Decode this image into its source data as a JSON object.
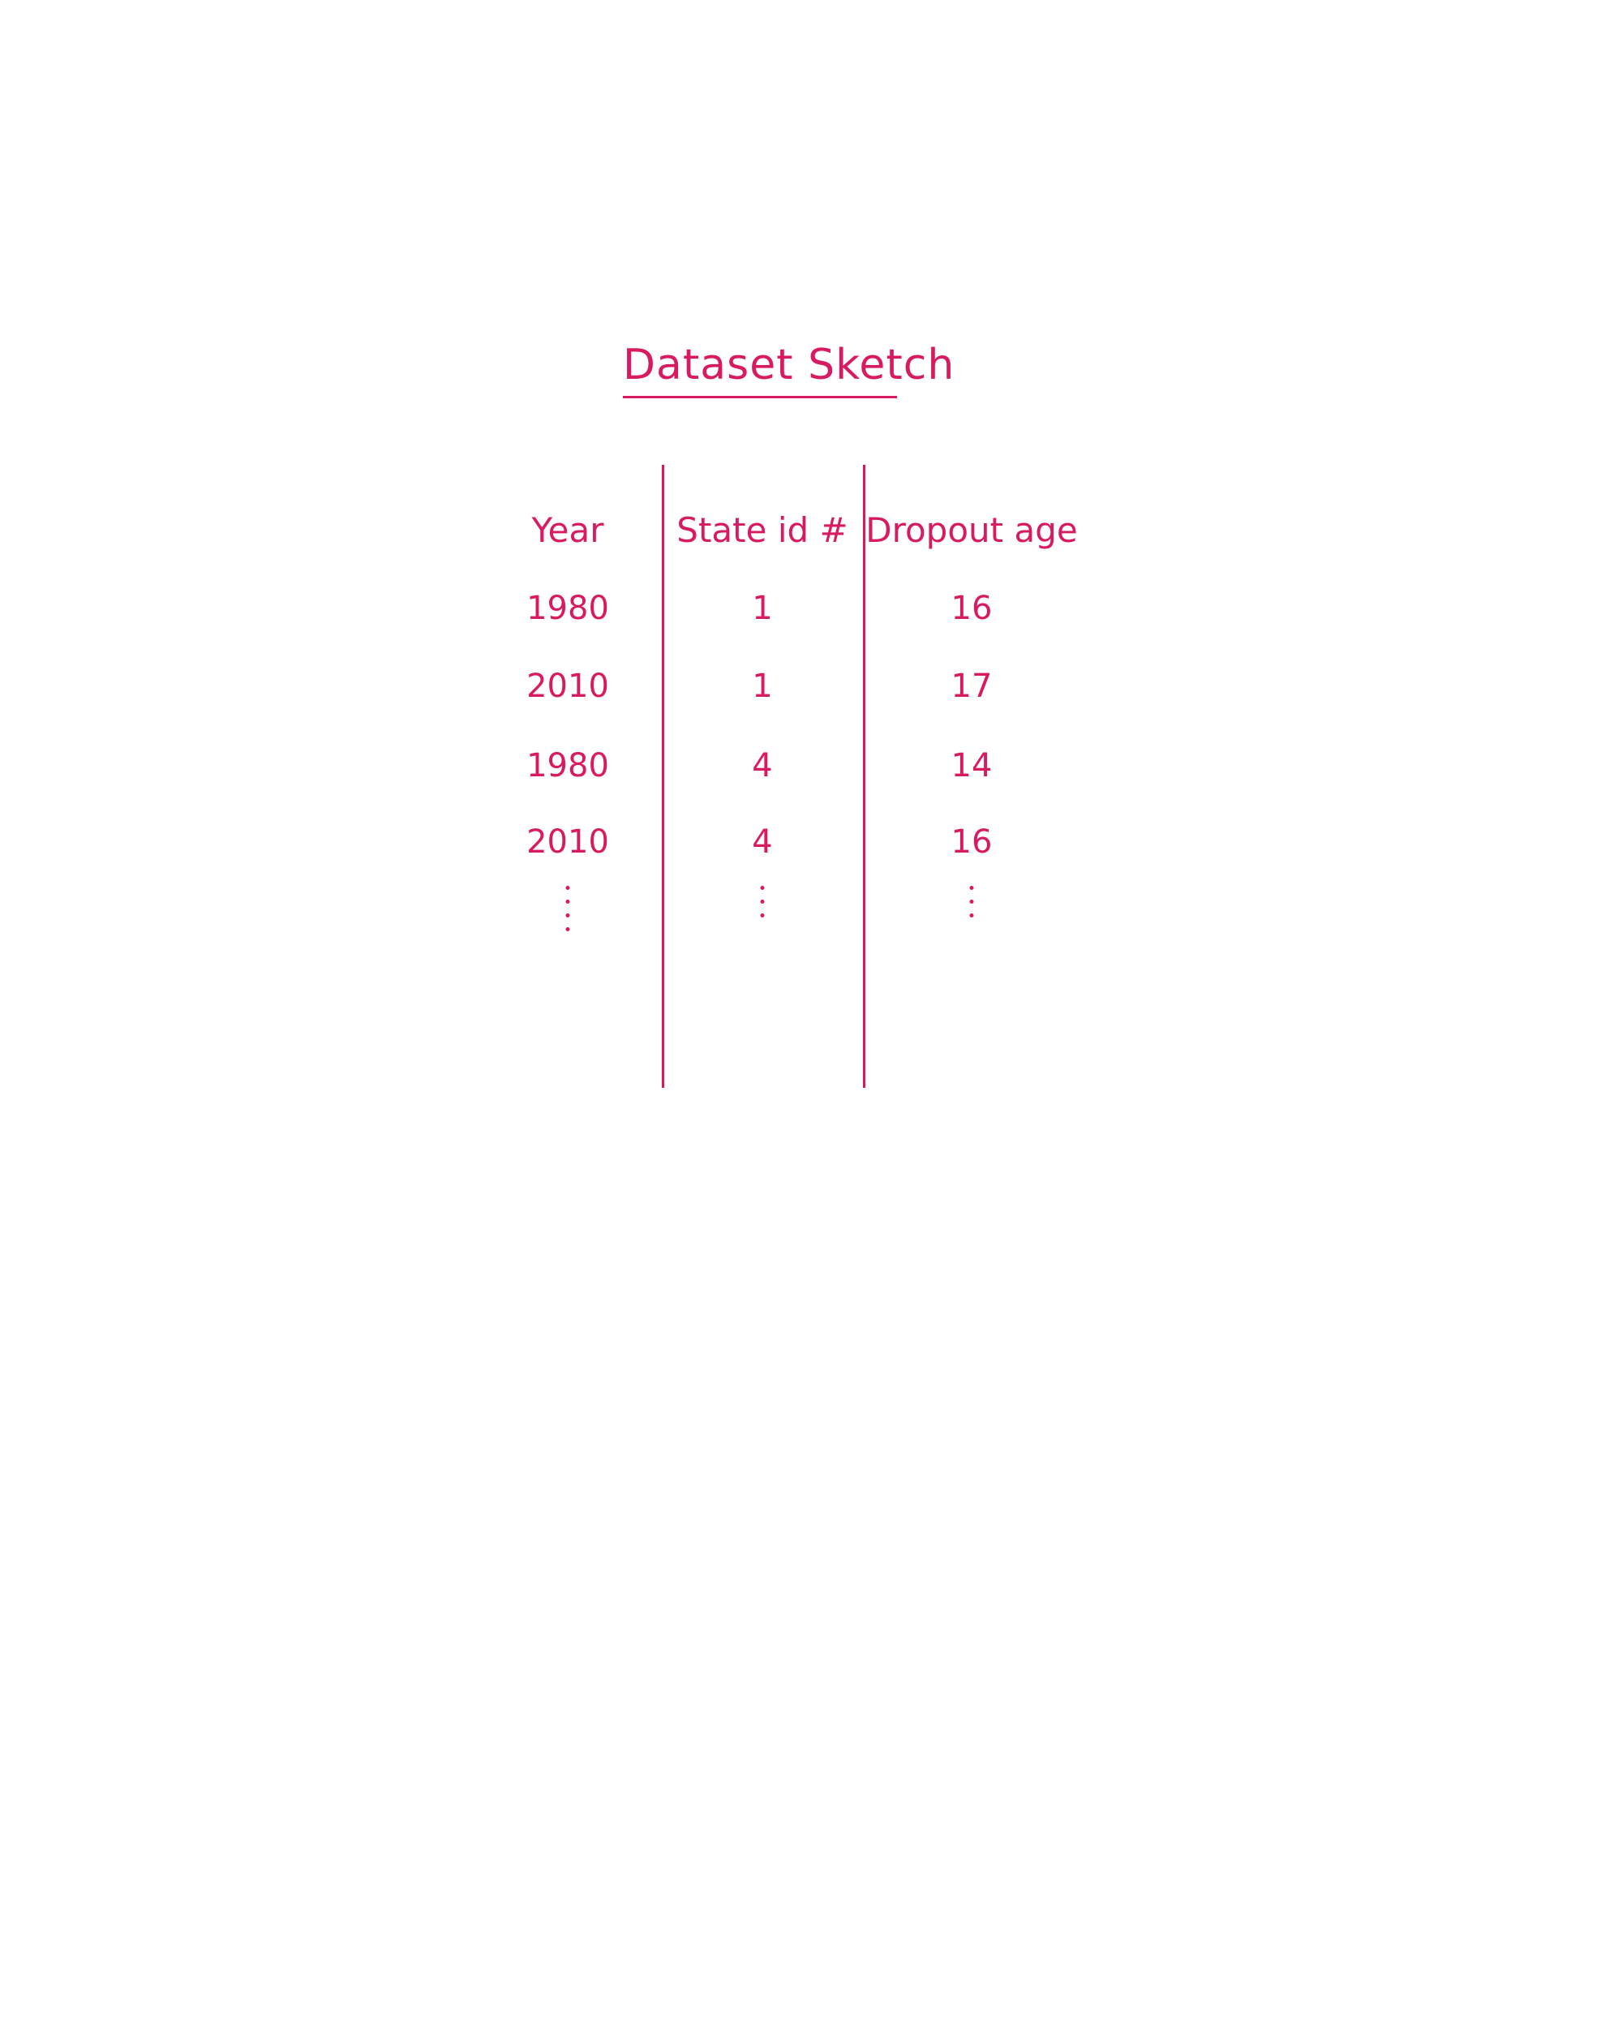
{
  "title": "Dataset Sketch",
  "colors": {
    "ink": "#d81b60",
    "background": "#ffffff"
  },
  "table": {
    "columns": [
      "Year",
      "State id #",
      "Dropout age"
    ],
    "rows": [
      [
        "1980",
        "1",
        "16"
      ],
      [
        "2010",
        "1",
        "17"
      ],
      [
        "1980",
        "4",
        "14"
      ],
      [
        "2010",
        "4",
        "16"
      ]
    ],
    "continuation": "⋮"
  }
}
